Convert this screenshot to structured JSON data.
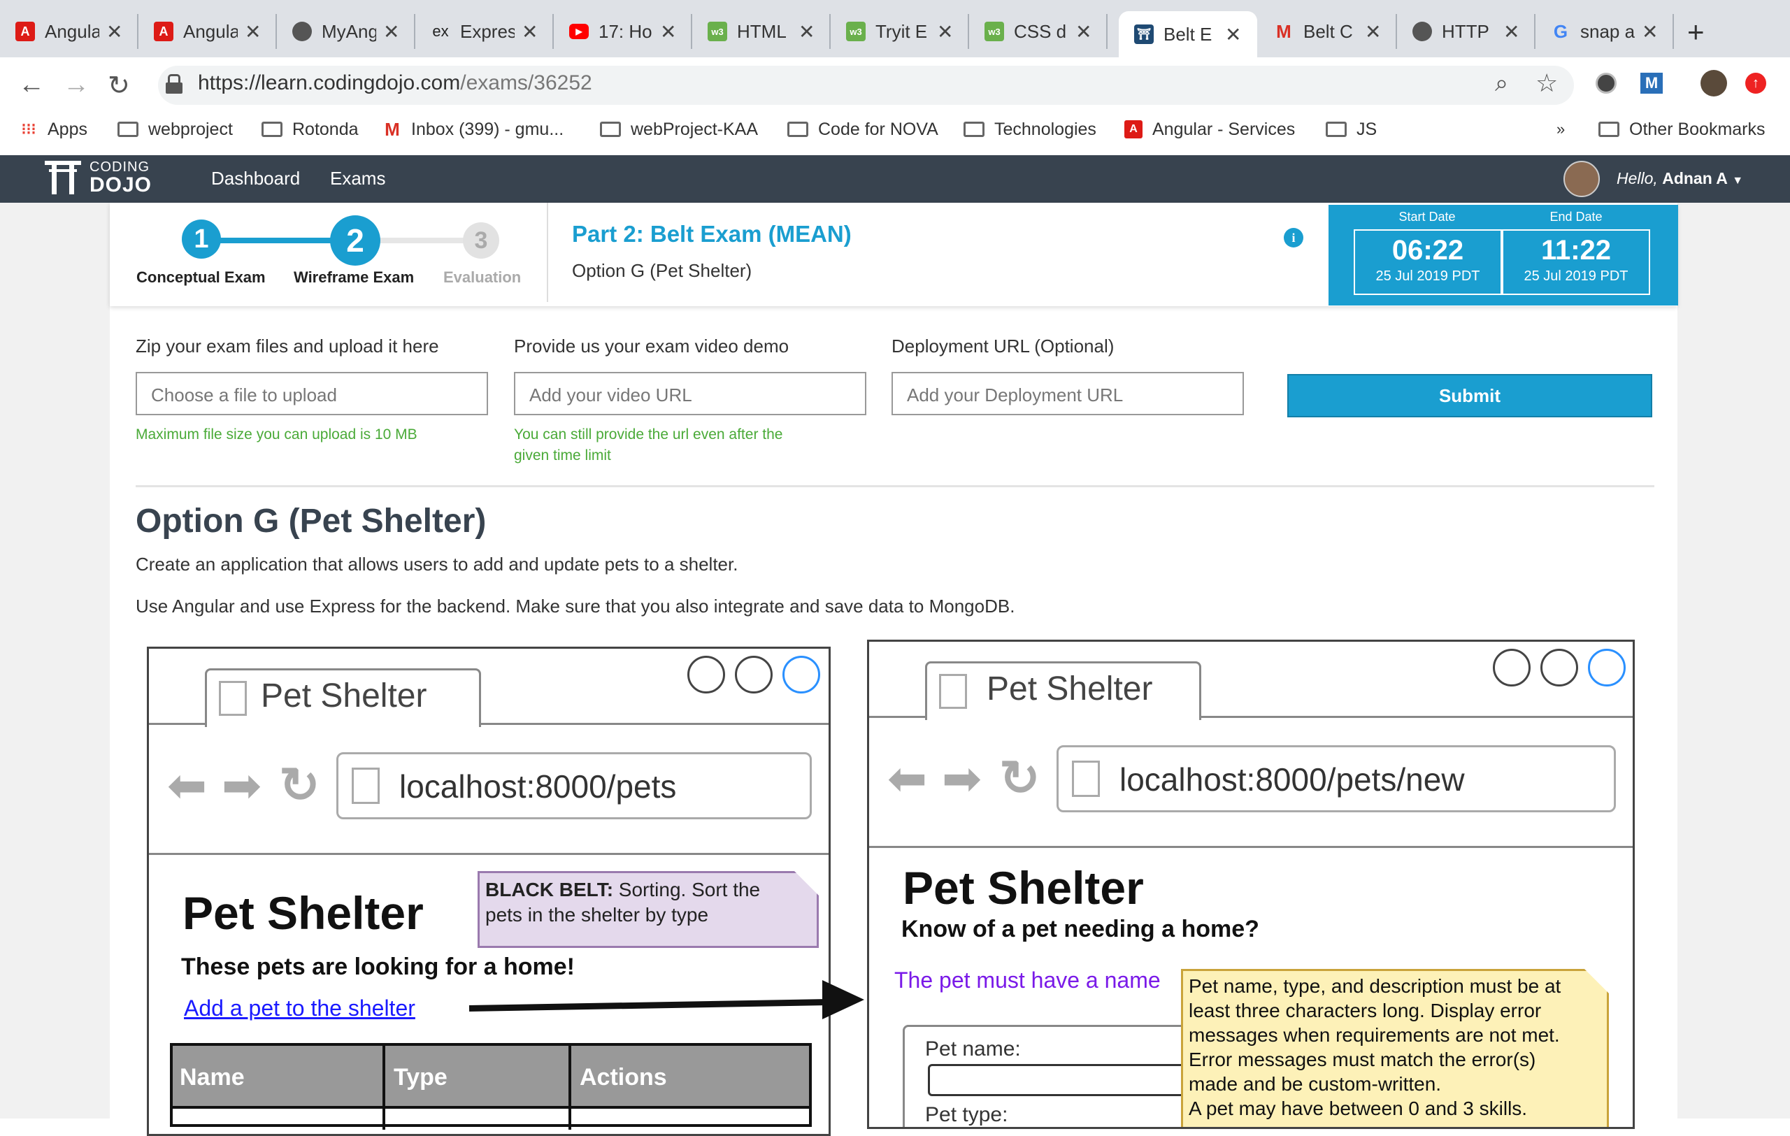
{
  "browser": {
    "tabs": [
      {
        "label": "Angula",
        "icon": "angular-icon"
      },
      {
        "label": "Angula",
        "icon": "angular-icon"
      },
      {
        "label": "MyAng",
        "icon": "globe-icon"
      },
      {
        "label": "Expres",
        "icon": "express-icon"
      },
      {
        "label": "17: Ho",
        "icon": "youtube-icon"
      },
      {
        "label": "HTML",
        "icon": "w3schools-icon"
      },
      {
        "label": "Tryit E",
        "icon": "w3schools-icon"
      },
      {
        "label": "CSS d",
        "icon": "w3schools-icon"
      },
      {
        "label": "Belt E",
        "icon": "codingdojo-icon"
      },
      {
        "label": "Belt C",
        "icon": "gmail-icon"
      },
      {
        "label": "HTTP",
        "icon": "globe-icon"
      },
      {
        "label": "snap a",
        "icon": "google-icon"
      }
    ],
    "url_main": "https://learn.codingdojo.com",
    "url_path": "/exams/36252",
    "bookmarks": [
      {
        "label": "Apps",
        "icon": "apps-grid-icon"
      },
      {
        "label": "webproject",
        "icon": "folder-icon"
      },
      {
        "label": "Rotonda",
        "icon": "folder-icon"
      },
      {
        "label": "Inbox (399) - gmu...",
        "icon": "gmail-icon"
      },
      {
        "label": "webProject-KAA",
        "icon": "folder-icon"
      },
      {
        "label": "Code for NOVA",
        "icon": "folder-icon"
      },
      {
        "label": "Technologies",
        "icon": "folder-icon"
      },
      {
        "label": "Angular - Services",
        "icon": "angular-icon"
      },
      {
        "label": "JS",
        "icon": "folder-icon"
      }
    ],
    "overflow": "»",
    "other_bookmarks": "Other Bookmarks",
    "ext_m": "M"
  },
  "site": {
    "logo_top": "CODING",
    "logo_bottom": "DOJO",
    "nav": [
      "Dashboard",
      "Exams"
    ],
    "greeting_prefix": "Hello,",
    "user": "Adnan A"
  },
  "progress": {
    "steps": [
      {
        "num": "1",
        "label": "Conceptual Exam"
      },
      {
        "num": "2",
        "label": "Wireframe Exam"
      },
      {
        "num": "3",
        "label": "Evaluation"
      }
    ],
    "exam_title": "Part 2: Belt Exam (MEAN)",
    "exam_option": "Option G (Pet Shelter)",
    "start_label": "Start Date",
    "end_label": "End Date",
    "start_time": "06:22",
    "start_date": "25 Jul 2019 PDT",
    "end_time": "11:22",
    "end_date": "25 Jul 2019 PDT"
  },
  "form": {
    "zip_label": "Zip your exam files and upload it here",
    "zip_placeholder": "Choose a file to upload",
    "zip_hint": "Maximum file size you can upload is 10 MB",
    "video_label": "Provide us your exam video demo",
    "video_placeholder": "Add your video URL",
    "video_hint_1": "You can still provide the url even after the",
    "video_hint_2": "given time limit",
    "deploy_label": "Deployment URL (Optional)",
    "deploy_placeholder": "Add your Deployment URL",
    "submit": "Submit"
  },
  "exam": {
    "heading": "Option G (Pet Shelter)",
    "desc1": "Create an application that allows users to add and update pets to a shelter.",
    "desc2": "Use Angular and use Express for the backend. Make sure that you also integrate and save data to MongoDB."
  },
  "wireframe1": {
    "tab_title": "Pet Shelter",
    "address": "localhost:8000/pets",
    "heading": "Pet Shelter",
    "subheading": "These pets are looking for a home!",
    "link": "Add a pet to the shelter",
    "note_bold": "BLACK BELT:",
    "note_line1": " Sorting. Sort the",
    "note_line2": "pets in the shelter by type",
    "columns": [
      "Name",
      "Type",
      "Actions"
    ]
  },
  "wireframe2": {
    "tab_title": "Pet Shelter",
    "address": "localhost:8000/pets/new",
    "heading": "Pet Shelter",
    "subheading": "Know of a pet needing a home?",
    "error": "The pet must have a name",
    "field_name": "Pet name:",
    "field_type": "Pet type:",
    "note_lines": [
      "Pet name, type, and description must be at",
      "least three characters long. Display error",
      "messages when requirements are not met.",
      "Error messages must match the error(s)",
      "made and be custom-written.",
      "A pet may have between 0 and 3 skills."
    ]
  },
  "colors": {
    "accent": "#1a9ed0",
    "nav_bg": "#38434f",
    "hint_green": "#4aaa38",
    "note_yellow": "#fdf1b8",
    "note_purple": "#e4d9ec"
  }
}
